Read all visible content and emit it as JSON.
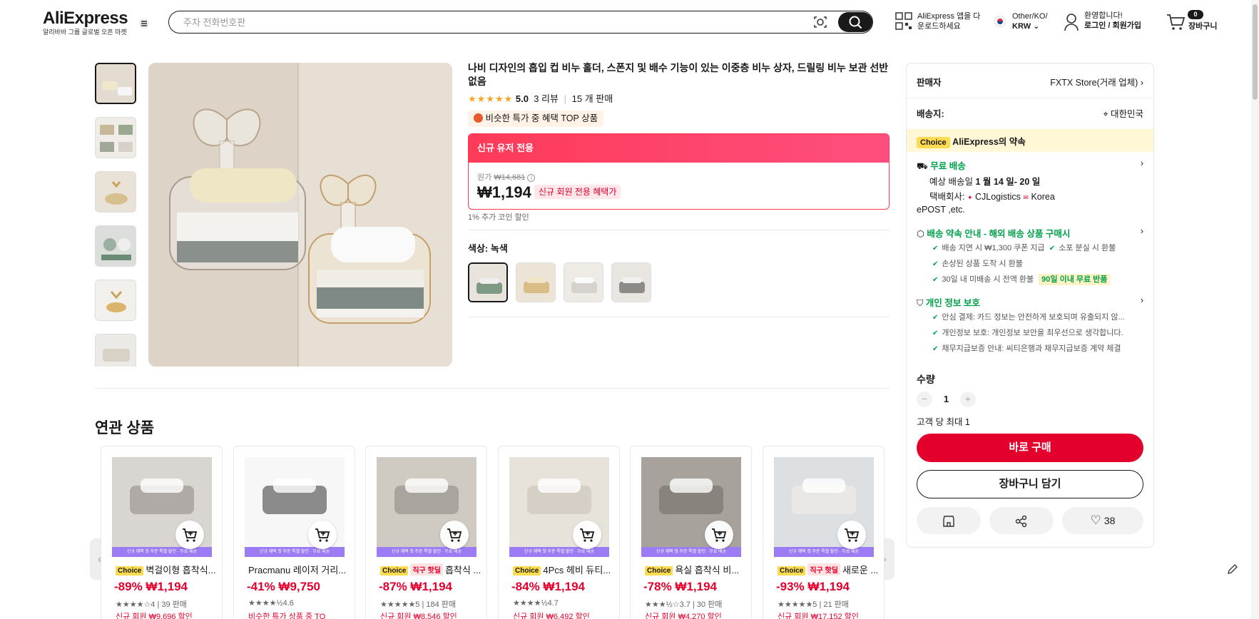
{
  "header": {
    "logo": "AliExpress",
    "logo_sub": "알리바바 그룹 글로벌 오픈 마켓",
    "search_placeholder": "주차 전화번호판",
    "app_line1": "AliExpress 앱을 다",
    "app_line2": "운로드하세요",
    "region_line1": "Other/KO/",
    "region_line2": "KRW",
    "welcome": "환영합니다!",
    "login": "로그인 / 회원가입",
    "cart_count": "0",
    "cart_label": "장바구니"
  },
  "product": {
    "title": "나비 디자인의 흡입 컵 비누 홀더, 스폰지 및 배수 기능이 있는 이중층 비누 상자, 드릴링 비누 보관 선반 없음",
    "rating": "5.0",
    "reviews": "3 리뷰",
    "sold": "15 개 판매",
    "top_badge": "비슷한 특가 중 혜택 TOP 상품",
    "promo_head": "신규 유저 전용",
    "orig_label": "원가",
    "orig_price": "₩14,681",
    "price": "₩1,194",
    "new_badge": "신규 회원 전용 혜택가",
    "coin": "1% 추가 코인 할인",
    "color_label": "색상: 녹색"
  },
  "panel": {
    "seller_label": "판매자",
    "seller_value": "FXTX Store(거래 업체)",
    "ship_label": "배송지:",
    "ship_value": "대한민국",
    "choice_tag": "Choice",
    "choice_text": "AliExpress의 약속",
    "free_ship": "무료 배송",
    "eta_prefix": "예상 배송일",
    "eta_value": "1 월 14 일- 20 일",
    "carrier_prefix": "택배회사:",
    "carrier1": "CJLogistics",
    "carrier2": "Korea",
    "carrier3": "ePOST ,etc.",
    "promise_title": "배송 약속 안내 - 해외 배송 상품 구매시",
    "promise1": "배송 지연 시 ₩1,300 쿠폰 지급",
    "promise2": "소포 분실 시 환불",
    "promise3": "손상된 상품 도착 시 환불",
    "promise4": "30일 내 미배송 시 전액 환불",
    "promise4_badge": "90일 이내 무료 반품",
    "privacy_title": "개인 정보 보호",
    "privacy1": "안심 결제: 카드 정보는 안전하게 보호되며 유출되지 않...",
    "privacy2": "개인정보 보호: 개인정보 보안을 최우선으로 생각합니다.",
    "privacy3": "채무지급보증 안내: 씨티은행과 채무지급보증 계약 체결",
    "qty_label": "수량",
    "qty_value": "1",
    "qty_limit": "고객 당 최대 1",
    "buy_now": "바로 구매",
    "add_cart": "장바구니 담기",
    "wish_count": "38"
  },
  "related": {
    "title": "연관 상품",
    "strip_text": "신규 혜택 첫 주문 특별 할인 · 무료 배송",
    "items": [
      {
        "tag": "Choice",
        "tag2": "",
        "name": "벽걸이형 흡착식...",
        "price": "-89% ₩1,194",
        "rating": "★★★★☆4 | 39 판매",
        "bottom": "신규 회원 ₩9,696 할인"
      },
      {
        "tag": "",
        "tag2": "",
        "name": "Pracmanu 레이저 거리...",
        "price": "-41% ₩9,750",
        "rating": "★★★★½4.6",
        "bottom": "비슷한 특가 상품 중 TO"
      },
      {
        "tag": "Choice",
        "tag2": "직구 핫딜",
        "name": "흡착식 ...",
        "price": "-87% ₩1,194",
        "rating": "★★★★★5 | 184 판매",
        "bottom": "신규 회원 ₩8,546 할인"
      },
      {
        "tag": "Choice",
        "tag2": "",
        "name": "4Pcs 헤비 듀티...",
        "price": "-84% ₩1,194",
        "rating": "★★★★½4.7",
        "bottom": "신규 회원 ₩6,492 할인"
      },
      {
        "tag": "Choice",
        "tag2": "",
        "name": "욕실 흡착식 비...",
        "price": "-78% ₩1,194",
        "rating": "★★★½☆3.7 | 30 판매",
        "bottom": "신규 회원 ₩4,270 할인"
      },
      {
        "tag": "Choice",
        "tag2": "직구 핫딜",
        "name": "새로운 ...",
        "price": "-93% ₩1,194",
        "rating": "★★★★★5 | 21 판매",
        "bottom": "신규 회원 ₩17,152 할인"
      }
    ]
  }
}
